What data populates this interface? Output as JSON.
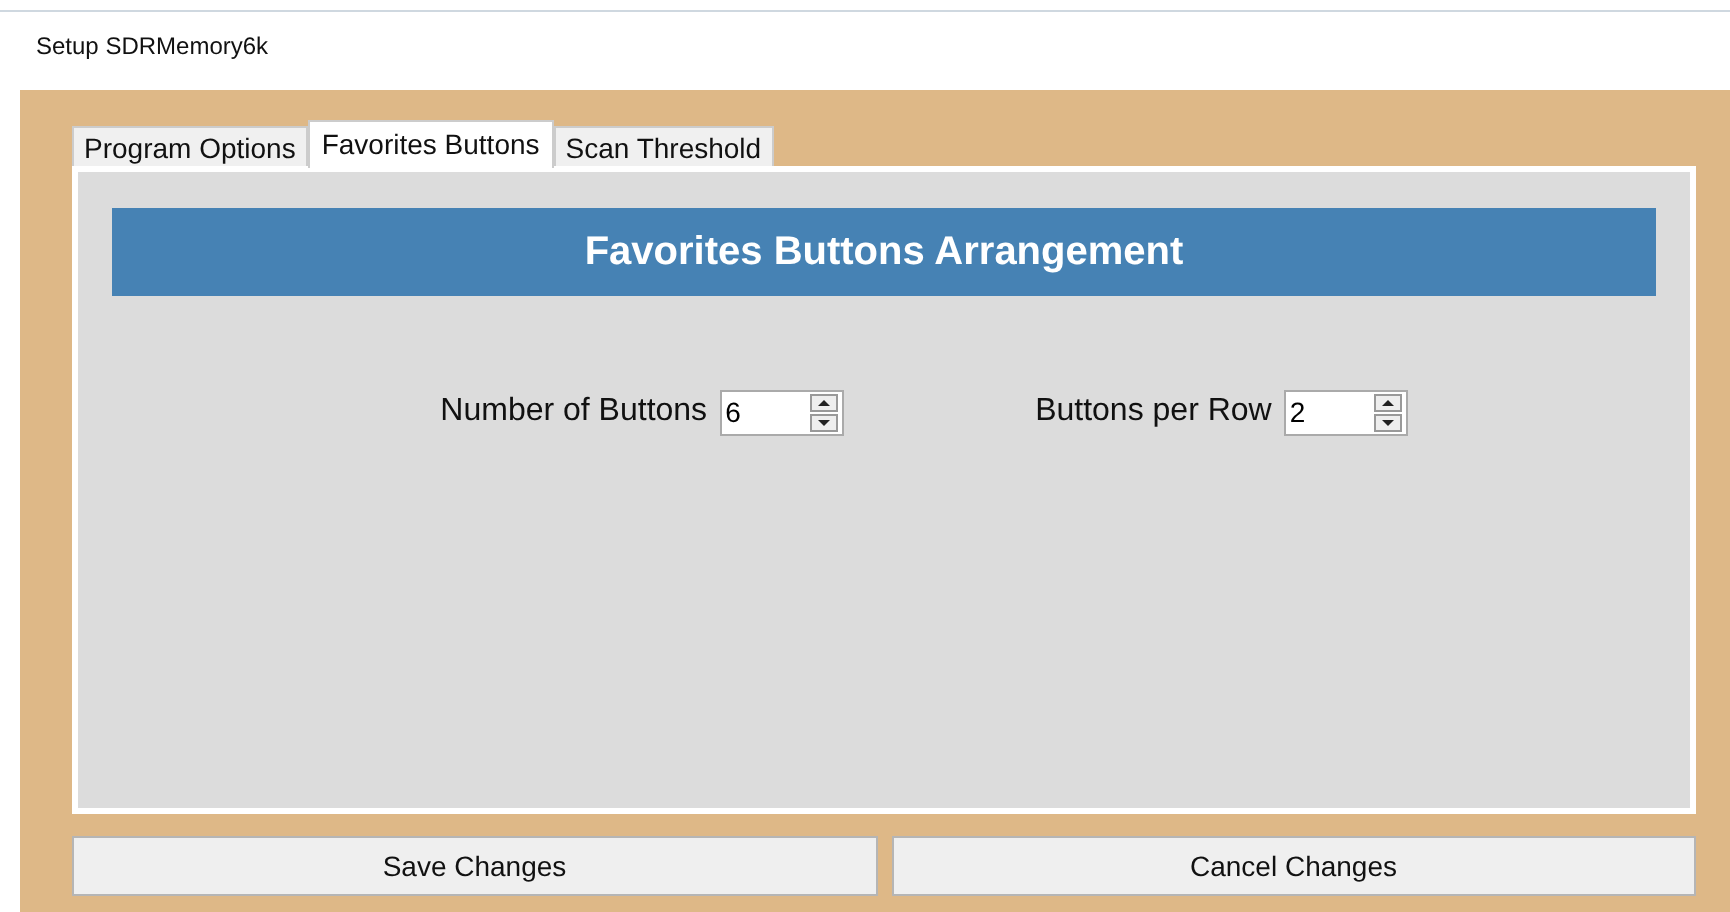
{
  "window": {
    "title": "Setup SDRMemory6k"
  },
  "tabs": [
    {
      "label": "Program Options",
      "selected": false
    },
    {
      "label": "Favorites Buttons",
      "selected": true
    },
    {
      "label": "Scan Threshold",
      "selected": false
    }
  ],
  "panel": {
    "heading": "Favorites Buttons Arrangement",
    "fields": [
      {
        "label": "Number of Buttons",
        "value": "6"
      },
      {
        "label": "Buttons per Row",
        "value": "2"
      }
    ]
  },
  "buttons": [
    "Save Changes",
    "Cancel Changes"
  ]
}
